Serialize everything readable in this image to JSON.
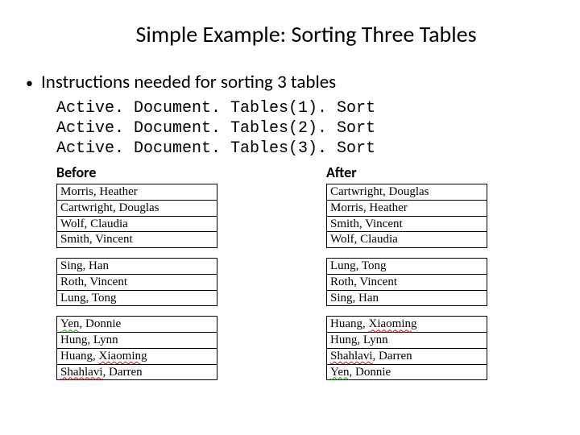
{
  "title": "Simple Example: Sorting Three Tables",
  "bullet": "Instructions needed for sorting 3 tables",
  "code": {
    "l1": "Active. Document. Tables(1). Sort",
    "l2": "Active. Document. Tables(2). Sort",
    "l3": "Active. Document. Tables(3). Sort"
  },
  "headers": {
    "before": "Before",
    "after": "After"
  },
  "before": {
    "t1": {
      "r1": "Morris, Heather",
      "r2": "Cartwright, Douglas",
      "r3": "Wolf, Claudia",
      "r4": "Smith, Vincent"
    },
    "t2": {
      "r1": "Sing, Han",
      "r2": "Roth, Vincent",
      "r3": "Lung, Tong"
    },
    "t3": {
      "r1a": "Yen",
      "r1b": ", Donnie",
      "r2": "Hung, Lynn",
      "r3a": "Huang, ",
      "r3b": "Xiaoming",
      "r4a": "Shahlavi",
      "r4b": ", Darren"
    }
  },
  "after": {
    "t1": {
      "r1": "Cartwright, Douglas",
      "r2": "Morris, Heather",
      "r3": "Smith, Vincent",
      "r4": "Wolf, Claudia"
    },
    "t2": {
      "r1": "Lung, Tong",
      "r2": "Roth, Vincent",
      "r3": "Sing, Han"
    },
    "t3": {
      "r1a": "Huang, ",
      "r1b": "Xiaoming",
      "r2": "Hung, Lynn",
      "r3a": "Shahlavi",
      "r3b": ", Darren",
      "r4a": "Yen",
      "r4b": ", Donnie"
    }
  }
}
